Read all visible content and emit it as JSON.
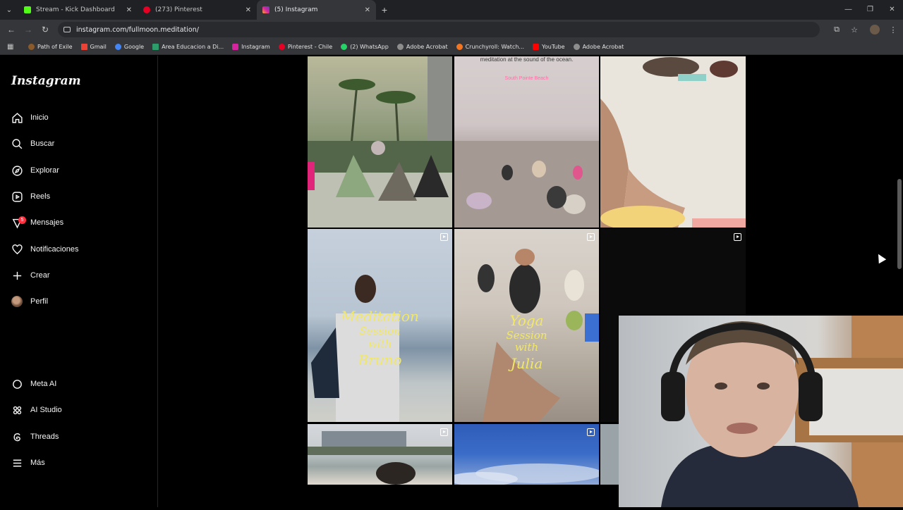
{
  "browser": {
    "tabs": [
      {
        "label": "Stream - Kick Dashboard",
        "favicon_color": "#53fc18"
      },
      {
        "label": "(273) Pinterest",
        "favicon_color": "#e60023"
      },
      {
        "label": "(5) Instagram",
        "favicon_color": "#d6249f"
      }
    ],
    "url": "instagram.com/fullmoon.meditation/",
    "bookmarks": [
      {
        "label": "Path of Exile",
        "color": "#8a5a2b"
      },
      {
        "label": "Gmail",
        "color": "#ea4335"
      },
      {
        "label": "Google",
        "color": "#4285f4"
      },
      {
        "label": "Area Educacion a Di...",
        "color": "#2e9b6a"
      },
      {
        "label": "Instagram",
        "color": "#d6249f"
      },
      {
        "label": "Pinterest - Chile",
        "color": "#e60023"
      },
      {
        "label": "(2) WhatsApp",
        "color": "#25d366"
      },
      {
        "label": "Adobe Acrobat",
        "color": "#8d8d8d"
      },
      {
        "label": "Crunchyroll: Watch...",
        "color": "#f47521"
      },
      {
        "label": "YouTube",
        "color": "#ff0000"
      },
      {
        "label": "Adobe Acrobat",
        "color": "#8d8d8d"
      }
    ]
  },
  "instagram": {
    "logo": "Instagram",
    "nav": [
      {
        "label": "Inicio",
        "icon": "home-icon"
      },
      {
        "label": "Buscar",
        "icon": "search-icon"
      },
      {
        "label": "Explorar",
        "icon": "compass-icon"
      },
      {
        "label": "Reels",
        "icon": "reels-icon"
      },
      {
        "label": "Mensajes",
        "icon": "messenger-icon",
        "badge": "5"
      },
      {
        "label": "Notificaciones",
        "icon": "heart-icon"
      },
      {
        "label": "Crear",
        "icon": "plus-icon"
      },
      {
        "label": "Perfil",
        "icon": "avatar"
      }
    ],
    "nav_bottom": [
      {
        "label": "Meta AI",
        "icon": "meta-ai-icon"
      },
      {
        "label": "AI Studio",
        "icon": "ai-studio-icon"
      },
      {
        "label": "Threads",
        "icon": "threads-icon"
      },
      {
        "label": "Más",
        "icon": "menu-icon"
      }
    ],
    "posts": {
      "p2_caption_top": "meditation at the sound of the ocean.",
      "p2_caption_place": "South Pointe Beach",
      "p4": {
        "line1": "Meditation",
        "line2": "Session",
        "line3": "with",
        "line4": "Bruno"
      },
      "p5": {
        "line1": "Yoga",
        "line2": "Session",
        "line3": "with",
        "line4": "Julia"
      }
    }
  }
}
